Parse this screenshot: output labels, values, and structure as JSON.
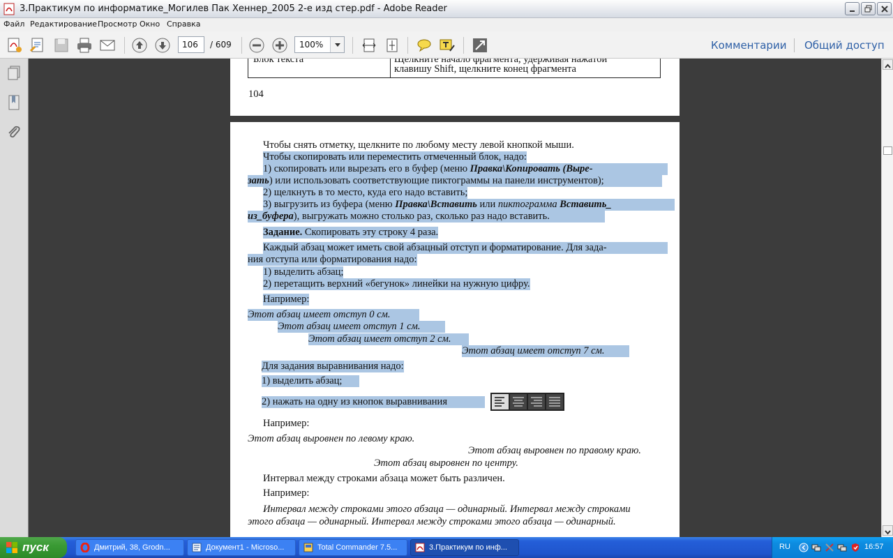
{
  "window": {
    "title": "3.Практикум по информатике_Могилев Пак Хеннер_2005 2-е изд стер.pdf - Adobe Reader"
  },
  "menu": [
    "Файл",
    "Редактирование",
    "Просмотр",
    "Окно",
    "Справка"
  ],
  "toolbar": {
    "page_current": "106",
    "page_total": "/ 609",
    "zoom": "100%",
    "comments_label": "Комментарии",
    "share_label": "Общий доступ"
  },
  "page_top": {
    "table_cell_left": "Блок текста",
    "table_cell_right_1": "Щелкните начало фрагмента, удерживая нажатой",
    "table_cell_right_2": "клавишу Shift, щелкните конец фрагмента",
    "page_number": "104"
  },
  "page_main": {
    "l1": "Чтобы снять отметку, щелкните по любому месту левой кнопкой мыши.",
    "l2": "Чтобы скопировать или переместить отмеченный блок, надо:",
    "l3a": "1) скопировать или вырезать его в буфер (меню ",
    "l3b": "Правка\\Копировать (Выре-",
    "l4a": "зать",
    "l4b": ") или использовать соответствующие пиктограммы на панели инструментов);",
    "l5": "2) щелкнуть в то место, куда его надо вставить;",
    "l6a": "3) выгрузить из буфера (меню ",
    "l6b": "Правка\\Вставить",
    "l6c": " или ",
    "l6d": "пиктограмма",
    "l6e": " Вставить_",
    "l7a": "из_буфера",
    "l7b": "), выгружать можно столько раз, сколько раз надо вставить.",
    "l8a": "Задание.",
    "l8b": " Скопировать эту строку 4 раза.",
    "l9": "Каждый абзац может иметь свой абзацный отступ и форматирование. Для зада-",
    "l10": "ния отступа или форматирования надо:",
    "l11": "1) выделить абзац;",
    "l12": "2) перетащить верхний «бегунок» линейки на нужную цифру.",
    "l13": "Например:",
    "i1": "Этот абзац имеет отступ 0 см.",
    "i2": "Этот абзац имеет отступ 1 см.",
    "i3": "Этот абзац имеет отступ 2 см.",
    "i4": "Этот абзац имеет отступ 7 см.",
    "l14": "Для задания выравнивания надо:",
    "l15": "1) выделить абзац;",
    "l16": "2) нажать на одну из кнопок выравнивания",
    "l17": "Например:",
    "a1": "Этот абзац выровнен по левому краю.",
    "a2": "Этот абзац выровнен по правому краю.",
    "a3": "Этот абзац выровнен по центру.",
    "l18": "Интервал между строками абзаца может быть различен.",
    "l19": "Например:",
    "s1": "Интервал между строками этого абзаца — одинарный. Интервал между строками",
    "s2": "этого абзаца — одинарный. Интервал между строками этого абзаца — одинарный."
  },
  "taskbar": {
    "start_label": "пуск",
    "tasks": [
      "Дмитрий, 38, Grodn...",
      "Документ1 - Microso...",
      "Total Commander 7.5...",
      "3.Практикум по инф..."
    ],
    "lang": "RU",
    "clock": "16:57"
  },
  "icons": {
    "app": "pdf-icon",
    "nav": [
      "pages-icon",
      "bookmarks-icon",
      "attachments-icon"
    ]
  },
  "colors": {
    "selection": "#abc6e3",
    "link": "#2d5fa6",
    "taskbar": "#245ed8",
    "start": "#3a9a34"
  }
}
